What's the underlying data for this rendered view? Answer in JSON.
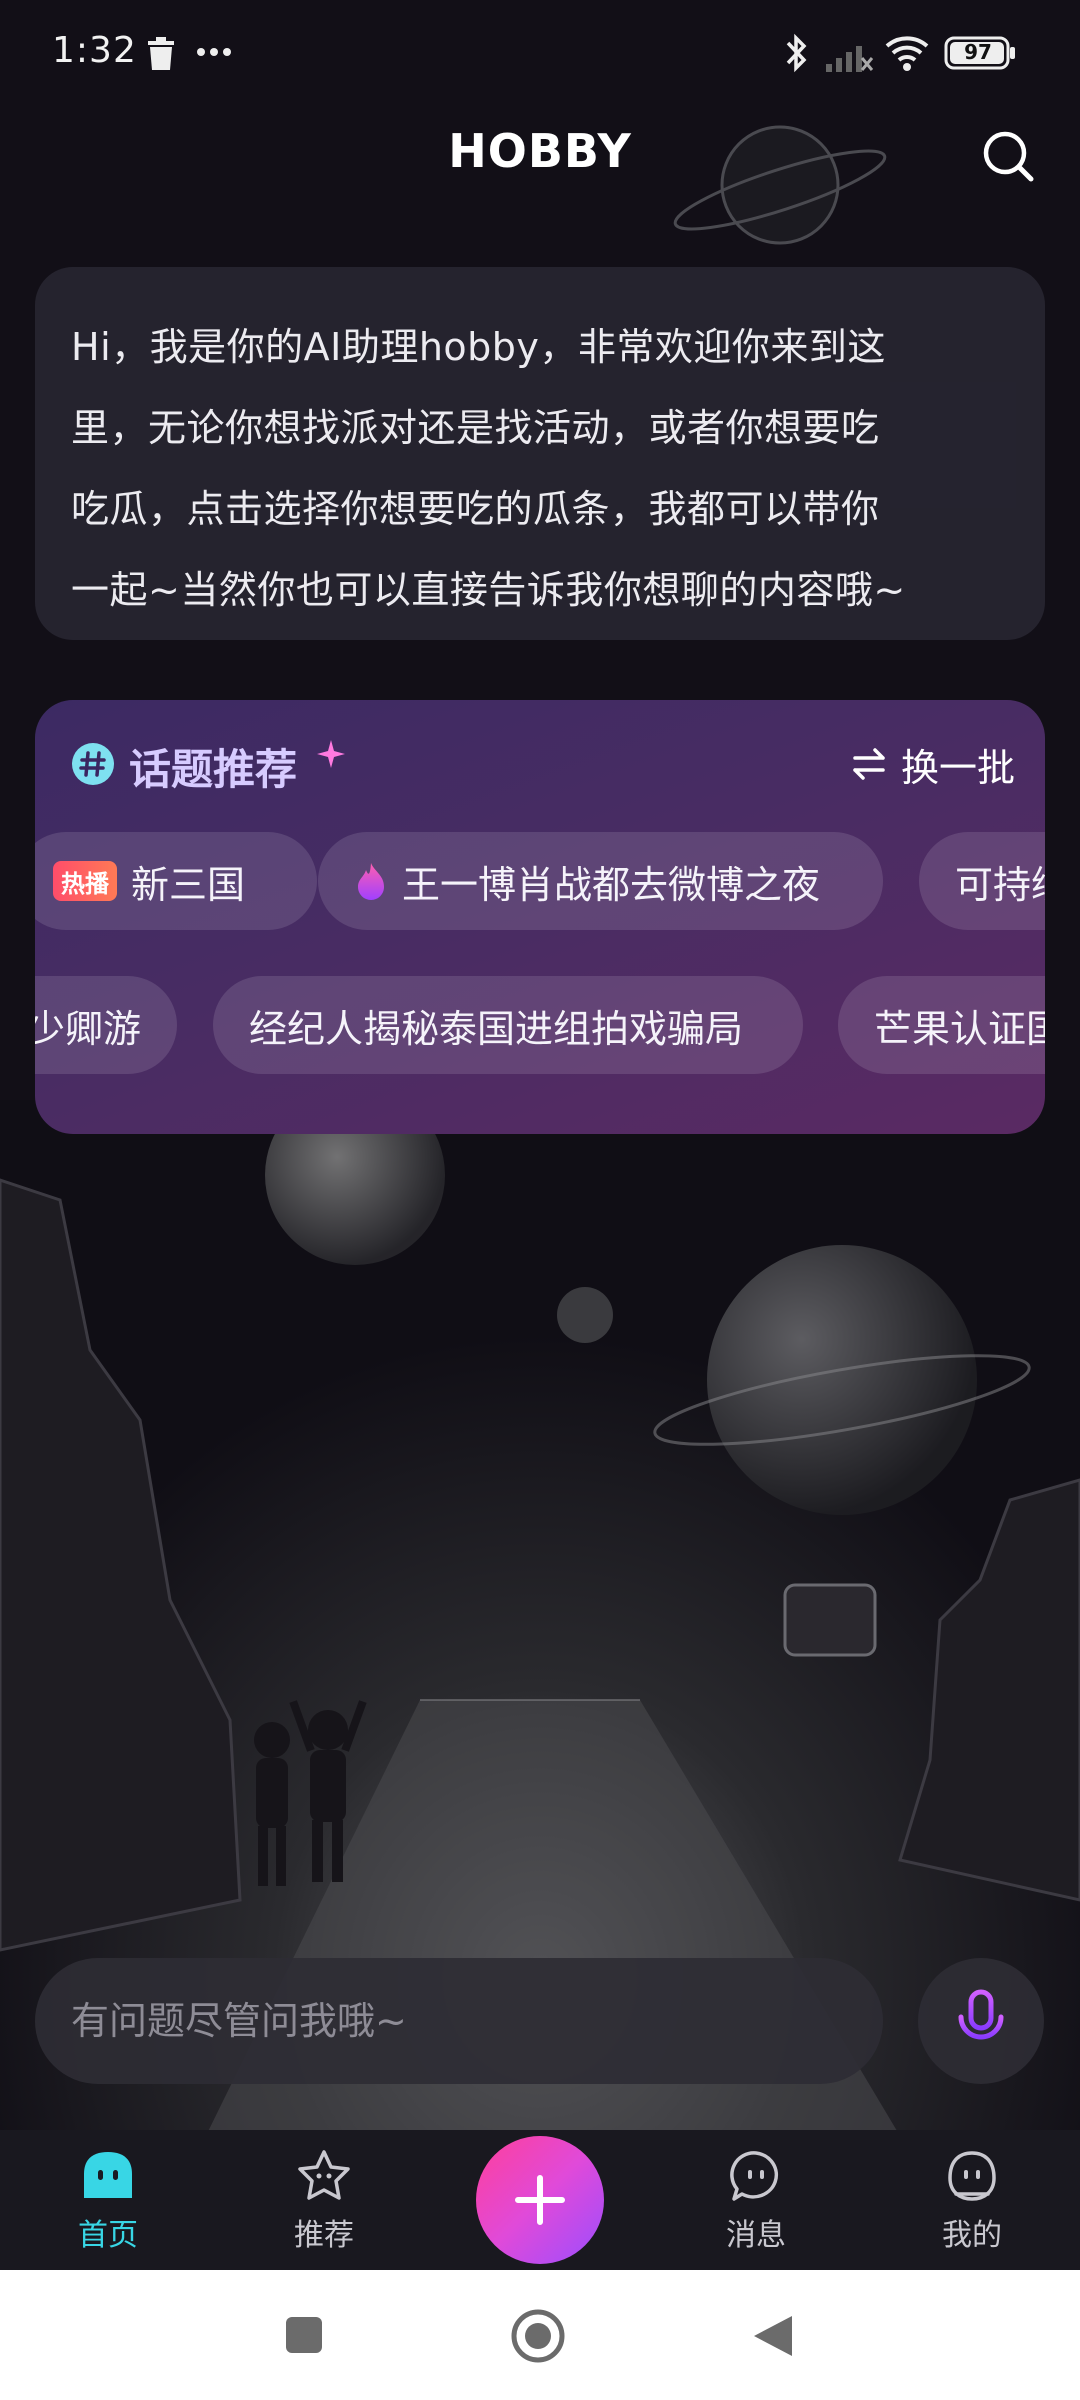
{
  "status_bar": {
    "time": "1:32",
    "battery": "97",
    "icons": [
      "trash-icon",
      "more-dots-icon",
      "bluetooth-icon",
      "signal-off-icon",
      "wifi-icon",
      "battery-icon"
    ]
  },
  "header": {
    "title": "HOBBY",
    "search_icon": "search-icon"
  },
  "greeting": {
    "lines": [
      "Hi，我是你的AI助理hobby，非常欢迎你来到这",
      "里，无论你想找派对还是找活动，或者你想要吃",
      "吃瓜，点击选择你想要吃的瓜条，我都可以带你",
      "一起~当然你也可以直接告诉我你想聊的内容哦~"
    ]
  },
  "topics": {
    "title": "话题推荐",
    "refresh_label": "换一批",
    "row1": [
      {
        "badge": "热播",
        "label": "新三国"
      },
      {
        "label": "王一博肖战都去微博之夜",
        "icon": "fire-icon"
      },
      {
        "label": "可持续"
      }
    ],
    "row2": [
      {
        "label": "少卿游"
      },
      {
        "label": "经纪人揭秘泰国进组拍戏骗局"
      },
      {
        "label": "芒果认证国"
      }
    ]
  },
  "input": {
    "placeholder": "有问题尽管问我哦~"
  },
  "bottom_nav": {
    "items": [
      {
        "label": "首页",
        "active": true
      },
      {
        "label": "推荐"
      },
      {
        "label": "消息"
      },
      {
        "label": "我的"
      }
    ],
    "accent": "#38d6e5",
    "plus_gradient": [
      "#ff3f9a",
      "#9b4dff"
    ]
  }
}
